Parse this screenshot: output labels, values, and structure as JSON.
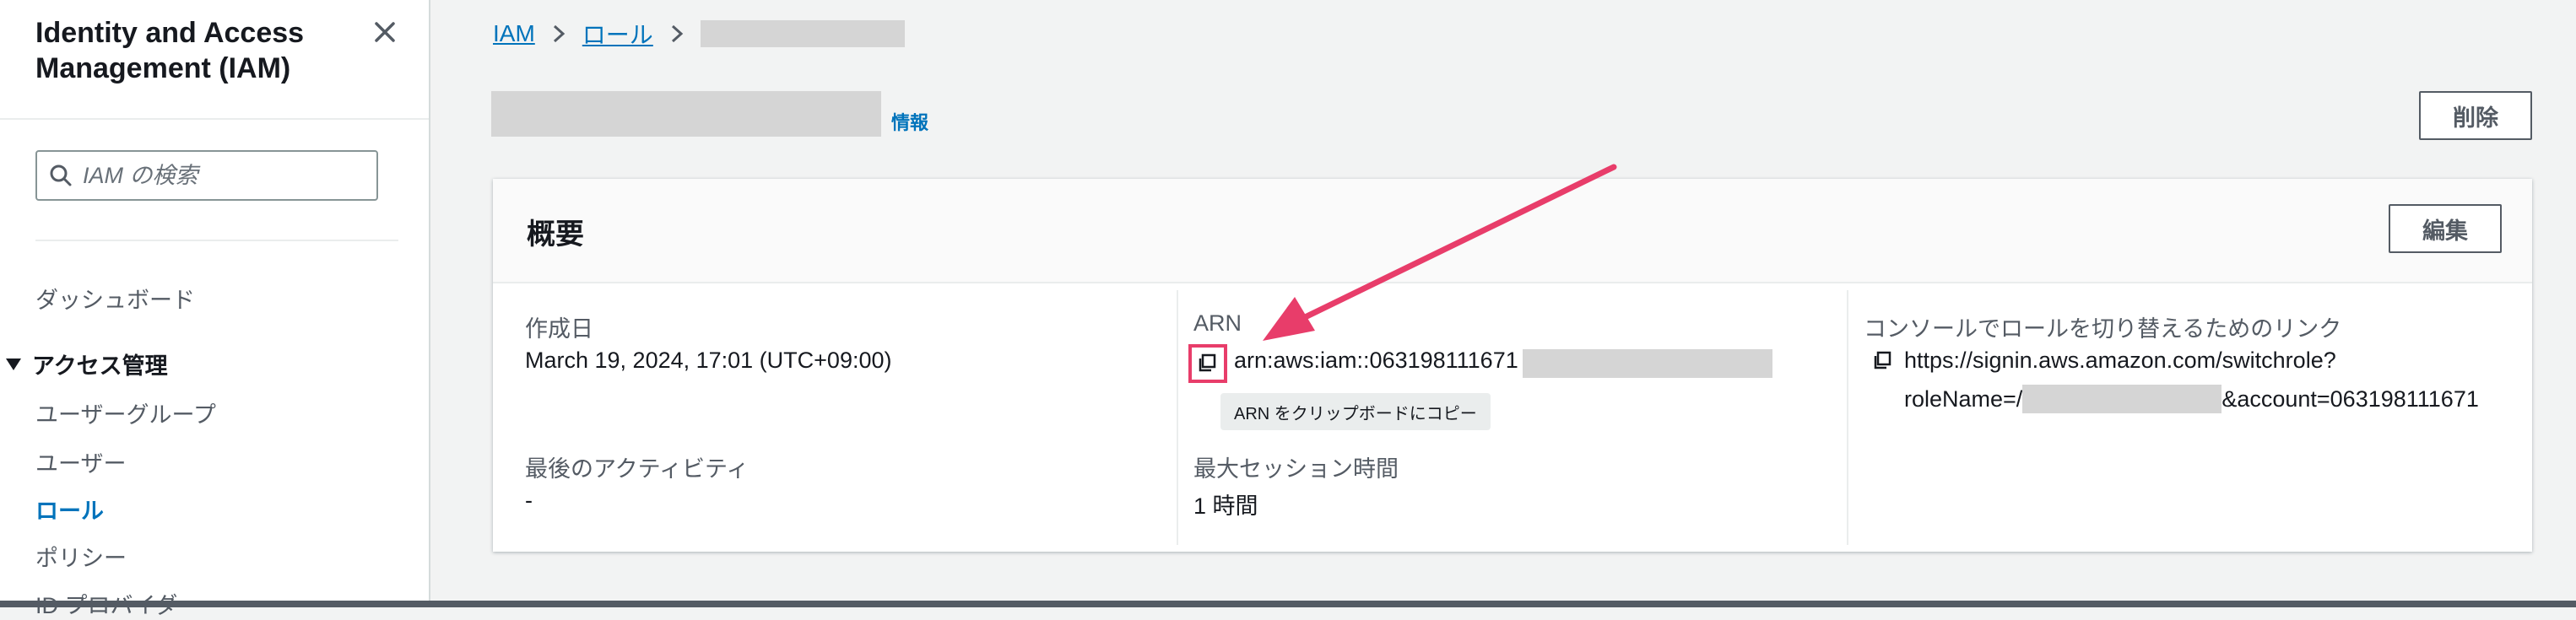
{
  "sidebar": {
    "title": "Identity and Access Management (IAM)",
    "search_placeholder": "IAM の検索",
    "dashboard": "ダッシュボード",
    "section": "アクセス管理",
    "items": [
      "ユーザーグループ",
      "ユーザー",
      "ロール",
      "ポリシー",
      "ID プロバイダ"
    ]
  },
  "breadcrumb": {
    "items": [
      "IAM",
      "ロール"
    ]
  },
  "page": {
    "info": "情報",
    "delete": "削除"
  },
  "summary": {
    "title": "概要",
    "edit": "編集",
    "created_label": "作成日",
    "created_value": "March 19, 2024, 17:01 (UTC+09:00)",
    "last_activity_label": "最後のアクティビティ",
    "last_activity_value": "-",
    "arn_label": "ARN",
    "arn_value": "arn:aws:iam::063198111671",
    "copy_tooltip": "ARN をクリップボードにコピー",
    "session_label": "最大セッション時間",
    "session_value": "1 時間",
    "link_label": "コンソールでロールを切り替えるためのリンク",
    "link_line1": "https://signin.aws.amazon.com/switchrole?",
    "link_prefix": "roleName=/",
    "link_suffix": "&account=063198111671"
  },
  "colors": {
    "link": "#0073bb",
    "highlight": "#e83d6a"
  }
}
